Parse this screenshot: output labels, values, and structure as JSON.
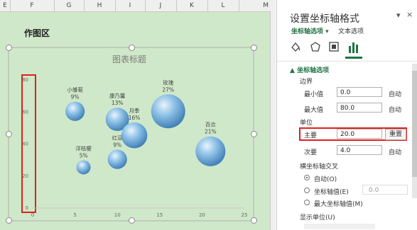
{
  "sheet": {
    "columns": [
      "E",
      "F",
      "G",
      "H",
      "I",
      "J",
      "K",
      "L",
      "M"
    ],
    "chart_area_label": "作图区"
  },
  "chart_data": {
    "type": "scatter",
    "title": "图表标题",
    "xlim": [
      0,
      25
    ],
    "ylim": [
      0,
      80
    ],
    "x_ticks": [
      "0",
      "5",
      "10",
      "15",
      "20",
      "25"
    ],
    "y_ticks": [
      "0",
      "20",
      "40",
      "60",
      "80"
    ],
    "points": [
      {
        "name": "小雏菊",
        "pct": "9%",
        "x": 5,
        "y": 60
      },
      {
        "name": "康乃馨",
        "pct": "13%",
        "x": 10,
        "y": 55
      },
      {
        "name": "月季",
        "pct": "16%",
        "x": 12,
        "y": 45
      },
      {
        "name": "玫瑰",
        "pct": "27%",
        "x": 16,
        "y": 60
      },
      {
        "name": "洋桔梗",
        "pct": "5%",
        "x": 6,
        "y": 25
      },
      {
        "name": "红豆",
        "pct": "9%",
        "x": 10,
        "y": 30
      },
      {
        "name": "百合",
        "pct": "21%",
        "x": 21,
        "y": 35
      }
    ],
    "bubble_color": "#7ab3de"
  },
  "pane": {
    "title": "设置坐标轴格式",
    "close_glyph": "×",
    "menu_glyph": "▾",
    "tab_axis_options": "坐标轴选项",
    "tab_text_options": "文本选项",
    "section_axis_options": "坐标轴选项",
    "bounds_label": "边界",
    "min_label": "最小值",
    "min_value": "0.0",
    "min_btn": "自动",
    "max_label": "最大值",
    "max_value": "80.0",
    "max_btn": "自动",
    "units_label": "单位",
    "major_label": "主要",
    "major_value": "20.0",
    "major_btn": "重置",
    "minor_label": "次要",
    "minor_value": "4.0",
    "minor_btn": "自动",
    "cross_label": "横坐标轴交叉",
    "cross_auto": "自动(O)",
    "cross_axis_value": "坐标轴值(E)",
    "cross_axis_value_input": "0.0",
    "cross_max": "最大坐标轴值(M)",
    "display_units": "显示单位(U)",
    "accent": "#217346",
    "highlight": "#e0201e"
  }
}
